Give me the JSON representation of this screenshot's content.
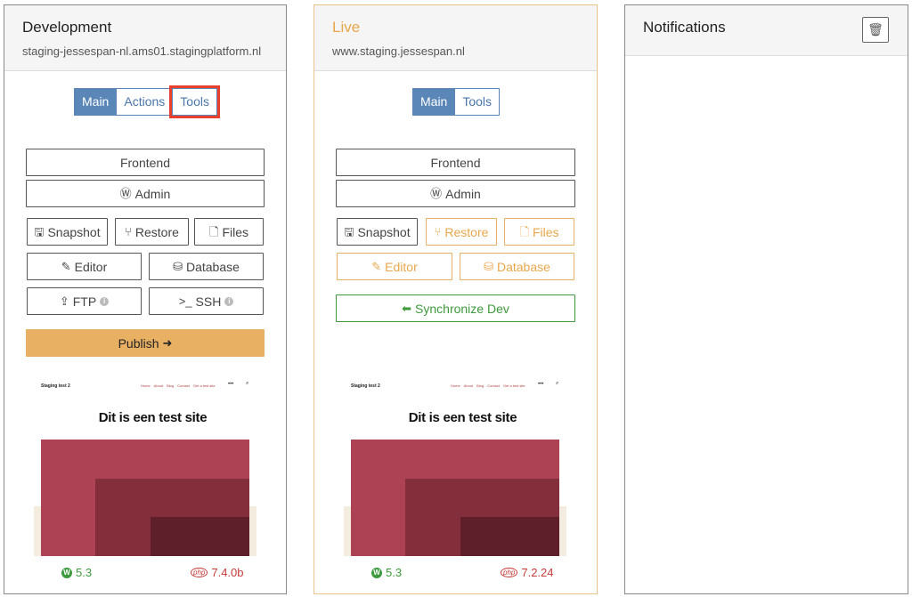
{
  "development": {
    "title": "Development",
    "url": "staging-jessespan-nl.ams01.stagingplatform.nl",
    "tabs": [
      "Main",
      "Actions",
      "Tools"
    ],
    "buttons": {
      "frontend": "Frontend",
      "admin": "Admin",
      "snapshot": "Snapshot",
      "restore": "Restore",
      "files": "Files",
      "editor": "Editor",
      "database": "Database",
      "ftp": "FTP",
      "ssh": "SSH",
      "publish": "Publish"
    },
    "preview": {
      "brand": "Staging test 2",
      "nav": [
        "Home",
        "About",
        "Blog",
        "Contact",
        "Get a test site"
      ],
      "heading": "Dit is een test site"
    },
    "wp_version": "5.3",
    "php_version": "7.4.0b"
  },
  "live": {
    "title": "Live",
    "url": "www.staging.jessespan.nl",
    "tabs": [
      "Main",
      "Tools"
    ],
    "buttons": {
      "frontend": "Frontend",
      "admin": "Admin",
      "snapshot": "Snapshot",
      "restore": "Restore",
      "files": "Files",
      "editor": "Editor",
      "database": "Database",
      "sync": "Synchronize Dev"
    },
    "preview": {
      "brand": "Staging test 2",
      "nav": [
        "Home",
        "About",
        "Blog",
        "Contact",
        "Get a test site"
      ],
      "heading": "Dit is een test site"
    },
    "wp_version": "5.3",
    "php_version": "7.2.24"
  },
  "notifications": {
    "title": "Notifications"
  },
  "colors": {
    "primary": "#5b87b8",
    "warning": "#e8b063",
    "success": "#3d9a3d",
    "danger": "#c63b3b",
    "highlight": "#e8402d"
  }
}
